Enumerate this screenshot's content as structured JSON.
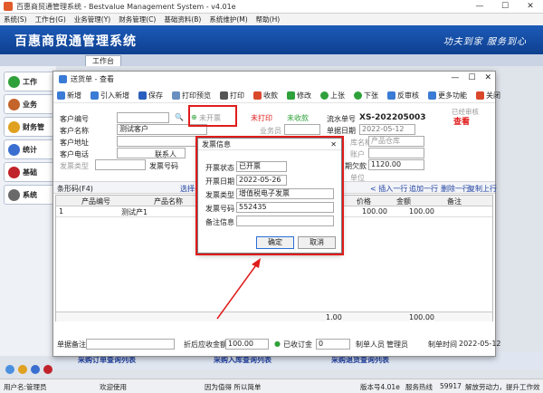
{
  "window": {
    "title": "百惠商贸通管理系统 - Bestvalue Management System - v4.01e",
    "min": "—",
    "max": "☐",
    "close": "✕"
  },
  "menu": [
    "系统(S)",
    "工作台(G)",
    "业务管理(Y)",
    "财务管理(C)",
    "基础资料(B)",
    "系统维护(M)",
    "帮助(H)"
  ],
  "banner": {
    "brand": "百惠商贸通管理系统",
    "slogan": "功夫到家 服务到心"
  },
  "tab": "工作台",
  "leftnav": [
    {
      "label": "工作",
      "icon": "check-icon",
      "color": "#2fa13a"
    },
    {
      "label": "业务",
      "icon": "box-icon",
      "color": "#c4642a"
    },
    {
      "label": "财务管",
      "icon": "folder-icon",
      "color": "#e0a020"
    },
    {
      "label": "统计",
      "icon": "chart-icon",
      "color": "#3a6fd0"
    },
    {
      "label": "基础",
      "icon": "book-icon",
      "color": "#c0242a"
    },
    {
      "label": "系统",
      "icon": "gear-icon",
      "color": "#6a6a6a"
    }
  ],
  "doc": {
    "title": "送货单 - 查看",
    "toolbar": [
      "新增",
      "引入新增",
      "保存",
      "打印预览",
      "打印",
      "收款",
      "修改",
      "上张",
      "下张",
      "反审核",
      "更多功能",
      "关闭"
    ],
    "status": {
      "unopened": "未开票",
      "unprinted": "未打印",
      "uncollected": "未收款",
      "audited": "已经审核",
      "view": "查看"
    },
    "fields": {
      "customer_code_label": "客户编号",
      "customer_name_label": "客户名称",
      "customer_name": "测试客户",
      "customer_addr_label": "客户地址",
      "customer_tel_label": "客户电话",
      "contact_label": "联系人",
      "type_label": "发票类型",
      "number_label": "发票号码",
      "salesman_label": "业务员",
      "serial_label": "流水单号",
      "serial": "XS-202205003",
      "date_label": "单据日期",
      "date": "2022-05-12",
      "warehouse_label": "库名称",
      "warehouse": "产品仓库",
      "account_label": "账户",
      "balance_label": "期欠款",
      "balance": "1120.00",
      "unit_label": "单位"
    },
    "bar": {
      "barcode": "条形码(F4)",
      "select": "选择←",
      "insert": "< 插入一行",
      "add": "追加一行",
      "delete": "删除一行",
      "copy": "复制上行"
    },
    "grid": {
      "headers": [
        "产品编号",
        "产品名称",
        "价格",
        "金额",
        "备注"
      ],
      "row": {
        "no": "1",
        "name": "测试产1",
        "price": "100.00",
        "amount": "100.00"
      },
      "qty_total": "1.00",
      "amount_total": "100.00"
    },
    "footer": {
      "remark_label": "单据备注",
      "after_label": "折后应收金额",
      "after": "100.00",
      "deposit_label": "已收订金",
      "deposit": "0",
      "maker_label": "制单人员",
      "maker": "管理员",
      "time_label": "制单时间",
      "time": "2022-05-12"
    }
  },
  "dialog": {
    "title": "发票信息",
    "close": "✕",
    "status_label": "开票状态",
    "status": "已开票",
    "date_label": "开票日期",
    "date": "2022-05-26",
    "type_label": "发票类型",
    "type": "增值税电子发票",
    "number_label": "发票号码",
    "number": "552435",
    "remark_label": "备注信息",
    "ok": "确定",
    "cancel": "取消"
  },
  "bottomlinks": [
    "采购订单查询列表",
    "采购入库查询列表",
    "采购退货查询列表"
  ],
  "statusbar": {
    "user": "用户名:管理员",
    "welcome": "欢迎使用",
    "slogan": "因为值得 所以简单",
    "version": "版本号4.01e",
    "service_label": "服务热线",
    "service": "59917",
    "motto": "解放劳动力，提升工作效"
  },
  "colors": {
    "accent": "#1c5bb8",
    "highlight": "#e01c1c"
  }
}
